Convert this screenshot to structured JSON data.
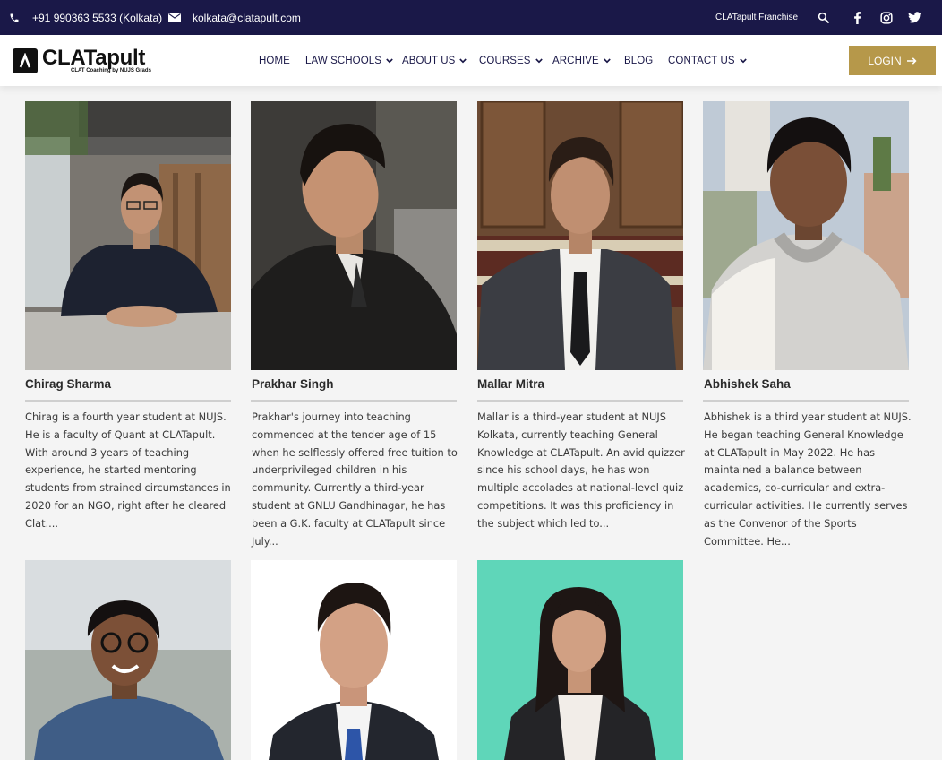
{
  "topbar": {
    "phone": "+91 990363 5533 (Kolkata)",
    "email": "kolkata@clatapult.com",
    "franchise": "CLATapult Franchise",
    "icons": [
      "phone-icon",
      "envelope-icon",
      "search-icon",
      "facebook-icon",
      "instagram-icon",
      "twitter-icon"
    ]
  },
  "header": {
    "logo_name": "CLATapult",
    "logo_tagline": "CLAT Coaching by NUJS Grads",
    "nav": [
      {
        "label": "HOME",
        "dropdown": false
      },
      {
        "label": "LAW SCHOOLS",
        "dropdown": true
      },
      {
        "label": "ABOUT US",
        "dropdown": true
      },
      {
        "label": "COURSES",
        "dropdown": true
      },
      {
        "label": "ARCHIVE",
        "dropdown": true
      },
      {
        "label": "BLOG",
        "dropdown": false
      },
      {
        "label": "CONTACT US",
        "dropdown": true
      }
    ],
    "login_label": "LOGIN"
  },
  "faculty": [
    {
      "name": "Chirag Sharma",
      "bio": "Chirag is a fourth year student at NUJS. He is a faculty of Quant at CLATapult. With around 3 years of teaching experience, he started mentoring students from strained circumstances in 2020 for an NGO, right after he cleared Clat....",
      "photo": "chirag-sharma-photo"
    },
    {
      "name": "Prakhar Singh",
      "bio": "Prakhar's journey into teaching commenced at the tender age of 15 when he selflessly offered free tuition to underprivileged children in his community. Currently a third-year student at GNLU Gandhinagar, he has been a G.K. faculty at CLATapult since July...",
      "photo": "prakhar-singh-photo"
    },
    {
      "name": "Mallar Mitra",
      "bio": "Mallar is a third-year student at NUJS Kolkata, currently teaching General Knowledge at CLATapult. An avid quizzer since his school days, he has won multiple accolades at national-level quiz competitions. It was this proficiency in the subject which led to...",
      "photo": "mallar-mitra-photo"
    },
    {
      "name": "Abhishek Saha",
      "bio": "Abhishek is a third year student at NUJS. He began teaching General Knowledge at CLATapult in May 2022. He has maintained a balance between academics, co-curricular and extra-curricular activities. He currently serves as the Convenor of the Sports Committee. He...",
      "photo": "abhishek-saha-photo"
    },
    {
      "name": "",
      "bio": "",
      "photo": "faculty-photo-5"
    },
    {
      "name": "",
      "bio": "",
      "photo": "faculty-photo-6"
    },
    {
      "name": "",
      "bio": "",
      "photo": "faculty-photo-7"
    }
  ],
  "colors": {
    "topbar_bg": "#1a1848",
    "nav_text": "#1a1848",
    "login_bg": "#b6984a",
    "page_bg": "#f4f4f4"
  }
}
